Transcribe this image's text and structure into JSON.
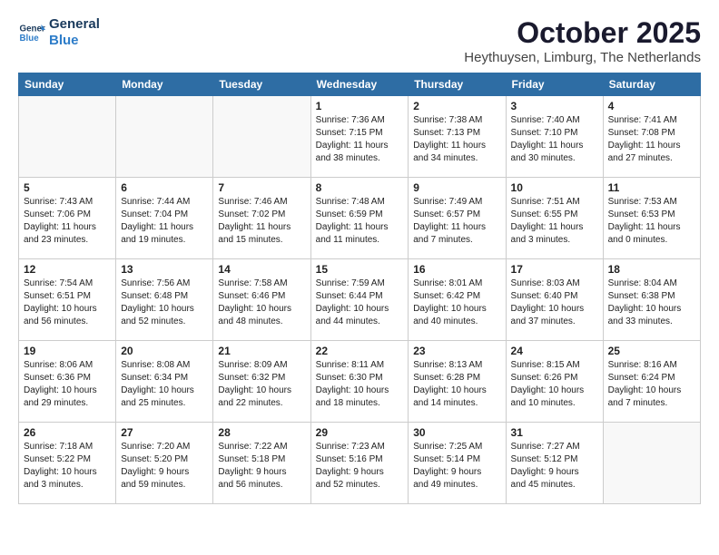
{
  "header": {
    "logo_line1": "General",
    "logo_line2": "Blue",
    "month": "October 2025",
    "location": "Heythuysen, Limburg, The Netherlands"
  },
  "weekdays": [
    "Sunday",
    "Monday",
    "Tuesday",
    "Wednesday",
    "Thursday",
    "Friday",
    "Saturday"
  ],
  "weeks": [
    [
      {
        "day": "",
        "info": ""
      },
      {
        "day": "",
        "info": ""
      },
      {
        "day": "",
        "info": ""
      },
      {
        "day": "1",
        "info": "Sunrise: 7:36 AM\nSunset: 7:15 PM\nDaylight: 11 hours\nand 38 minutes."
      },
      {
        "day": "2",
        "info": "Sunrise: 7:38 AM\nSunset: 7:13 PM\nDaylight: 11 hours\nand 34 minutes."
      },
      {
        "day": "3",
        "info": "Sunrise: 7:40 AM\nSunset: 7:10 PM\nDaylight: 11 hours\nand 30 minutes."
      },
      {
        "day": "4",
        "info": "Sunrise: 7:41 AM\nSunset: 7:08 PM\nDaylight: 11 hours\nand 27 minutes."
      }
    ],
    [
      {
        "day": "5",
        "info": "Sunrise: 7:43 AM\nSunset: 7:06 PM\nDaylight: 11 hours\nand 23 minutes."
      },
      {
        "day": "6",
        "info": "Sunrise: 7:44 AM\nSunset: 7:04 PM\nDaylight: 11 hours\nand 19 minutes."
      },
      {
        "day": "7",
        "info": "Sunrise: 7:46 AM\nSunset: 7:02 PM\nDaylight: 11 hours\nand 15 minutes."
      },
      {
        "day": "8",
        "info": "Sunrise: 7:48 AM\nSunset: 6:59 PM\nDaylight: 11 hours\nand 11 minutes."
      },
      {
        "day": "9",
        "info": "Sunrise: 7:49 AM\nSunset: 6:57 PM\nDaylight: 11 hours\nand 7 minutes."
      },
      {
        "day": "10",
        "info": "Sunrise: 7:51 AM\nSunset: 6:55 PM\nDaylight: 11 hours\nand 3 minutes."
      },
      {
        "day": "11",
        "info": "Sunrise: 7:53 AM\nSunset: 6:53 PM\nDaylight: 11 hours\nand 0 minutes."
      }
    ],
    [
      {
        "day": "12",
        "info": "Sunrise: 7:54 AM\nSunset: 6:51 PM\nDaylight: 10 hours\nand 56 minutes."
      },
      {
        "day": "13",
        "info": "Sunrise: 7:56 AM\nSunset: 6:48 PM\nDaylight: 10 hours\nand 52 minutes."
      },
      {
        "day": "14",
        "info": "Sunrise: 7:58 AM\nSunset: 6:46 PM\nDaylight: 10 hours\nand 48 minutes."
      },
      {
        "day": "15",
        "info": "Sunrise: 7:59 AM\nSunset: 6:44 PM\nDaylight: 10 hours\nand 44 minutes."
      },
      {
        "day": "16",
        "info": "Sunrise: 8:01 AM\nSunset: 6:42 PM\nDaylight: 10 hours\nand 40 minutes."
      },
      {
        "day": "17",
        "info": "Sunrise: 8:03 AM\nSunset: 6:40 PM\nDaylight: 10 hours\nand 37 minutes."
      },
      {
        "day": "18",
        "info": "Sunrise: 8:04 AM\nSunset: 6:38 PM\nDaylight: 10 hours\nand 33 minutes."
      }
    ],
    [
      {
        "day": "19",
        "info": "Sunrise: 8:06 AM\nSunset: 6:36 PM\nDaylight: 10 hours\nand 29 minutes."
      },
      {
        "day": "20",
        "info": "Sunrise: 8:08 AM\nSunset: 6:34 PM\nDaylight: 10 hours\nand 25 minutes."
      },
      {
        "day": "21",
        "info": "Sunrise: 8:09 AM\nSunset: 6:32 PM\nDaylight: 10 hours\nand 22 minutes."
      },
      {
        "day": "22",
        "info": "Sunrise: 8:11 AM\nSunset: 6:30 PM\nDaylight: 10 hours\nand 18 minutes."
      },
      {
        "day": "23",
        "info": "Sunrise: 8:13 AM\nSunset: 6:28 PM\nDaylight: 10 hours\nand 14 minutes."
      },
      {
        "day": "24",
        "info": "Sunrise: 8:15 AM\nSunset: 6:26 PM\nDaylight: 10 hours\nand 10 minutes."
      },
      {
        "day": "25",
        "info": "Sunrise: 8:16 AM\nSunset: 6:24 PM\nDaylight: 10 hours\nand 7 minutes."
      }
    ],
    [
      {
        "day": "26",
        "info": "Sunrise: 7:18 AM\nSunset: 5:22 PM\nDaylight: 10 hours\nand 3 minutes."
      },
      {
        "day": "27",
        "info": "Sunrise: 7:20 AM\nSunset: 5:20 PM\nDaylight: 9 hours\nand 59 minutes."
      },
      {
        "day": "28",
        "info": "Sunrise: 7:22 AM\nSunset: 5:18 PM\nDaylight: 9 hours\nand 56 minutes."
      },
      {
        "day": "29",
        "info": "Sunrise: 7:23 AM\nSunset: 5:16 PM\nDaylight: 9 hours\nand 52 minutes."
      },
      {
        "day": "30",
        "info": "Sunrise: 7:25 AM\nSunset: 5:14 PM\nDaylight: 9 hours\nand 49 minutes."
      },
      {
        "day": "31",
        "info": "Sunrise: 7:27 AM\nSunset: 5:12 PM\nDaylight: 9 hours\nand 45 minutes."
      },
      {
        "day": "",
        "info": ""
      }
    ]
  ]
}
